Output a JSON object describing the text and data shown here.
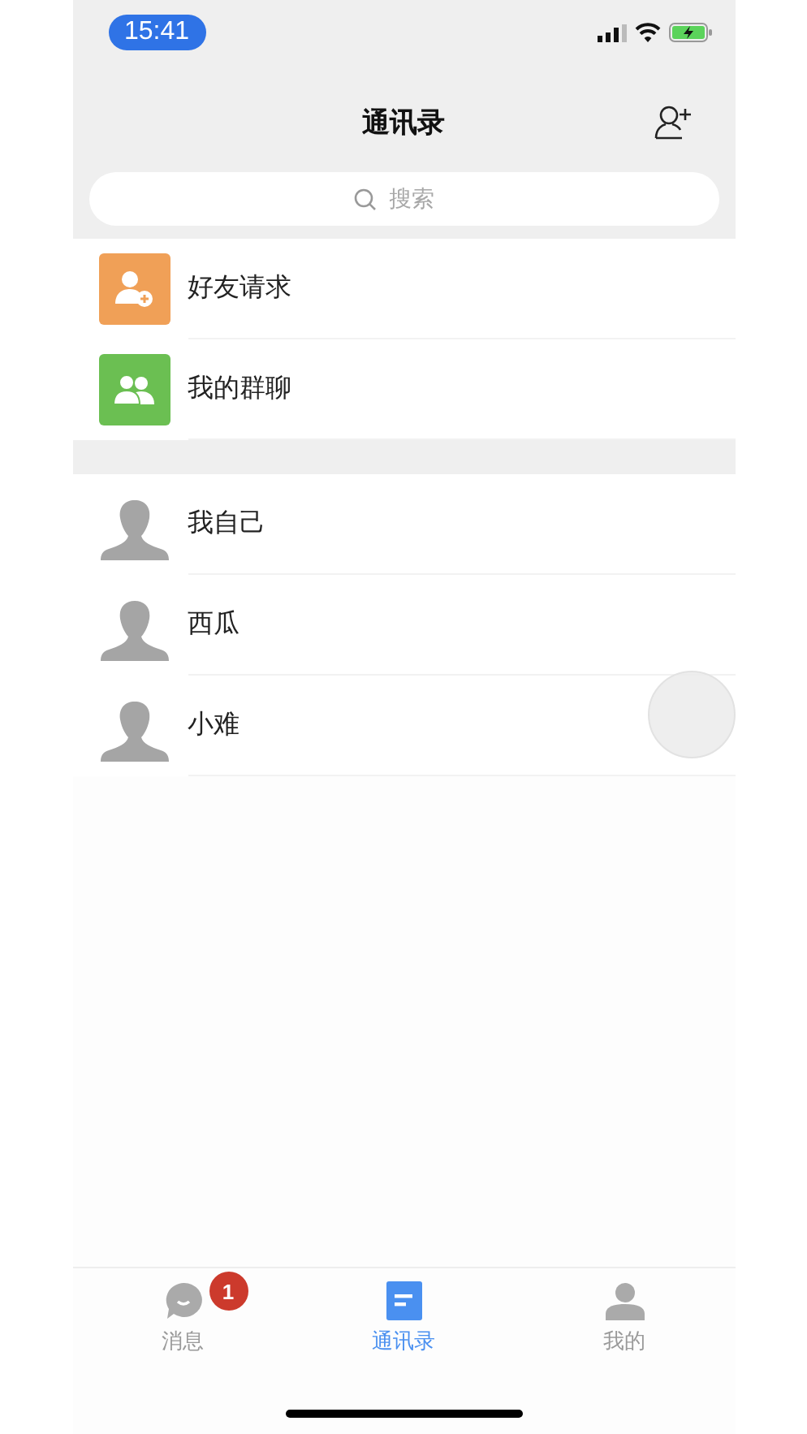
{
  "status_bar": {
    "time": "15:41"
  },
  "header": {
    "title": "通讯录"
  },
  "search": {
    "placeholder": "搜索"
  },
  "shortcuts": [
    {
      "kind": "friend_request",
      "label": "好友请求"
    },
    {
      "kind": "group_chat",
      "label": "我的群聊"
    }
  ],
  "contacts": [
    {
      "name": "我自己"
    },
    {
      "name": "西瓜"
    },
    {
      "name": "小难"
    }
  ],
  "tab_bar": [
    {
      "kind": "messages",
      "label": "消息",
      "selected": false,
      "badge": "1"
    },
    {
      "kind": "contacts",
      "label": "通讯录",
      "selected": true
    },
    {
      "kind": "profile",
      "label": "我的",
      "selected": false
    }
  ]
}
